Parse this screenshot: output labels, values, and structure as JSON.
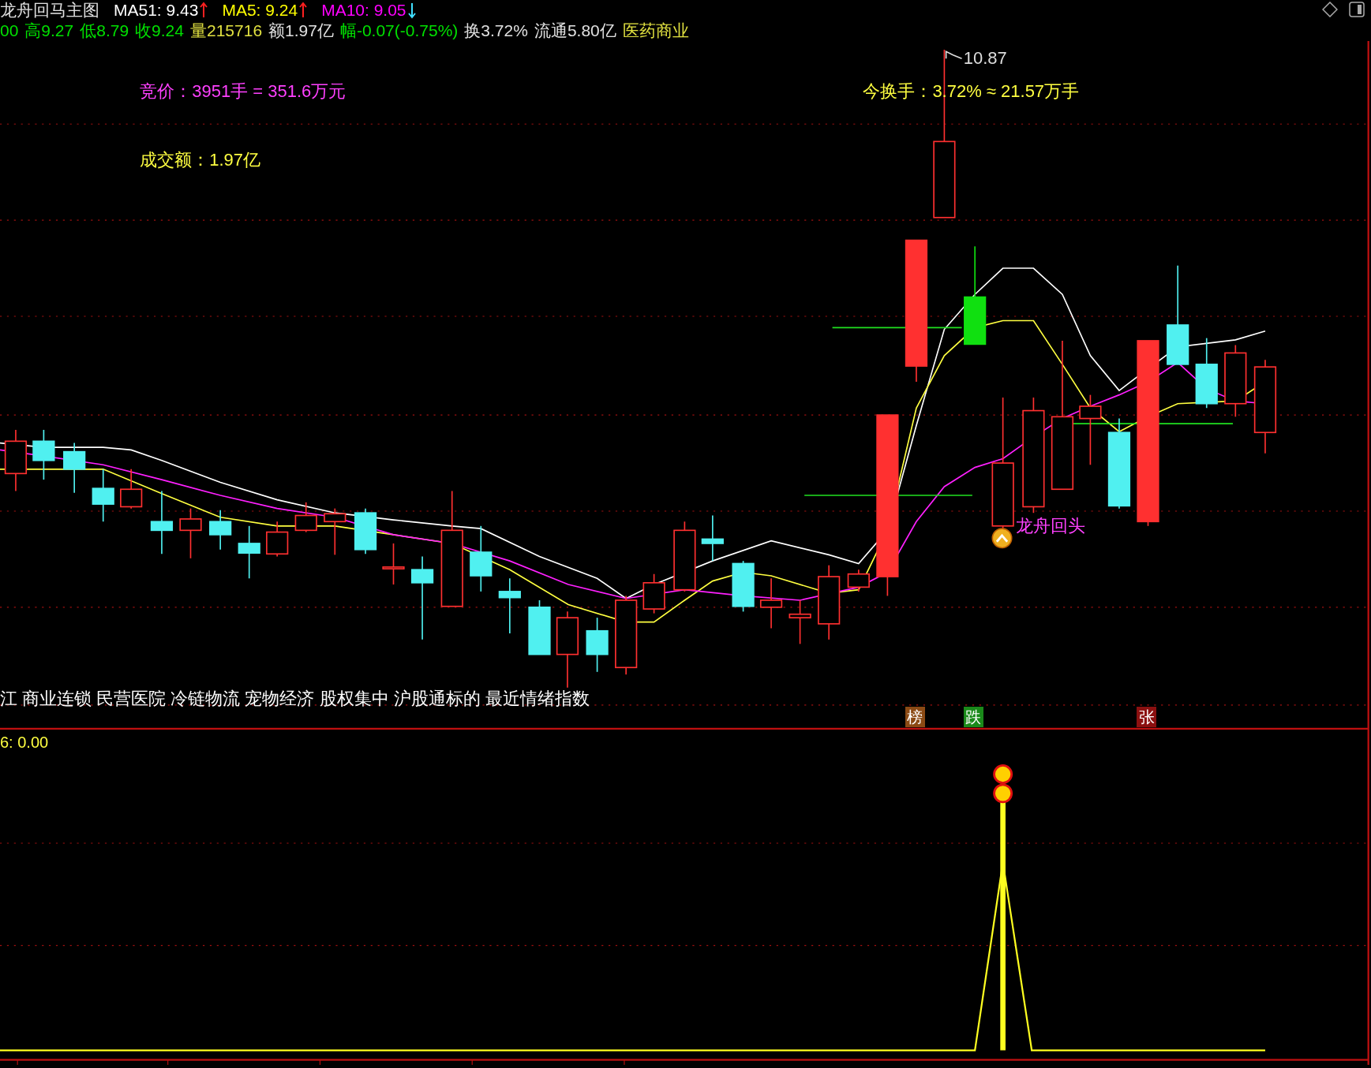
{
  "header": {
    "title": "龙舟回马主图",
    "indicators": [
      {
        "label": "MA51: 9.43",
        "color": "#ffffff",
        "rising": true
      },
      {
        "label": "MA5: 9.24",
        "color": "#ffff00",
        "rising": true
      },
      {
        "label": "MA10: 9.05",
        "color": "#ff00ff",
        "rising": false
      }
    ]
  },
  "quote_line": [
    {
      "text": "00",
      "color": "#00e000"
    },
    {
      "text": "高9.27",
      "color": "#00e000"
    },
    {
      "text": "低8.79",
      "color": "#00e000"
    },
    {
      "text": "收9.24",
      "color": "#00e000"
    },
    {
      "text": "量215716",
      "color": "#e0e040"
    },
    {
      "text": "额1.97亿",
      "color": "#e0e0e0"
    },
    {
      "text": "幅-0.07(-0.75%)",
      "color": "#00e000"
    },
    {
      "text": "换3.72%",
      "color": "#e0e0e0"
    },
    {
      "text": "流通5.80亿",
      "color": "#e0e0e0"
    },
    {
      "text": "医药商业",
      "color": "#e0e040"
    }
  ],
  "annotations": {
    "auction": "竞价：3951手 = 351.6万元",
    "turnover_amount": "成交额：1.97亿",
    "turnover_rate": "今换手：3.72% ≈ 21.57万手",
    "high_price": "10.87",
    "signal_label": "龙舟回头"
  },
  "concepts": "江 商业连锁 民营医院 冷链物流 宠物经济 股权集中 沪股通标的 最近情绪指数",
  "badges": [
    {
      "label": "榜",
      "color": "#8b4a14"
    },
    {
      "label": "跌",
      "color": "#1a8a1a"
    },
    {
      "label": "张",
      "color": "#8b1010"
    }
  ],
  "sub_panel": {
    "reading": "6: 0.00"
  }
}
